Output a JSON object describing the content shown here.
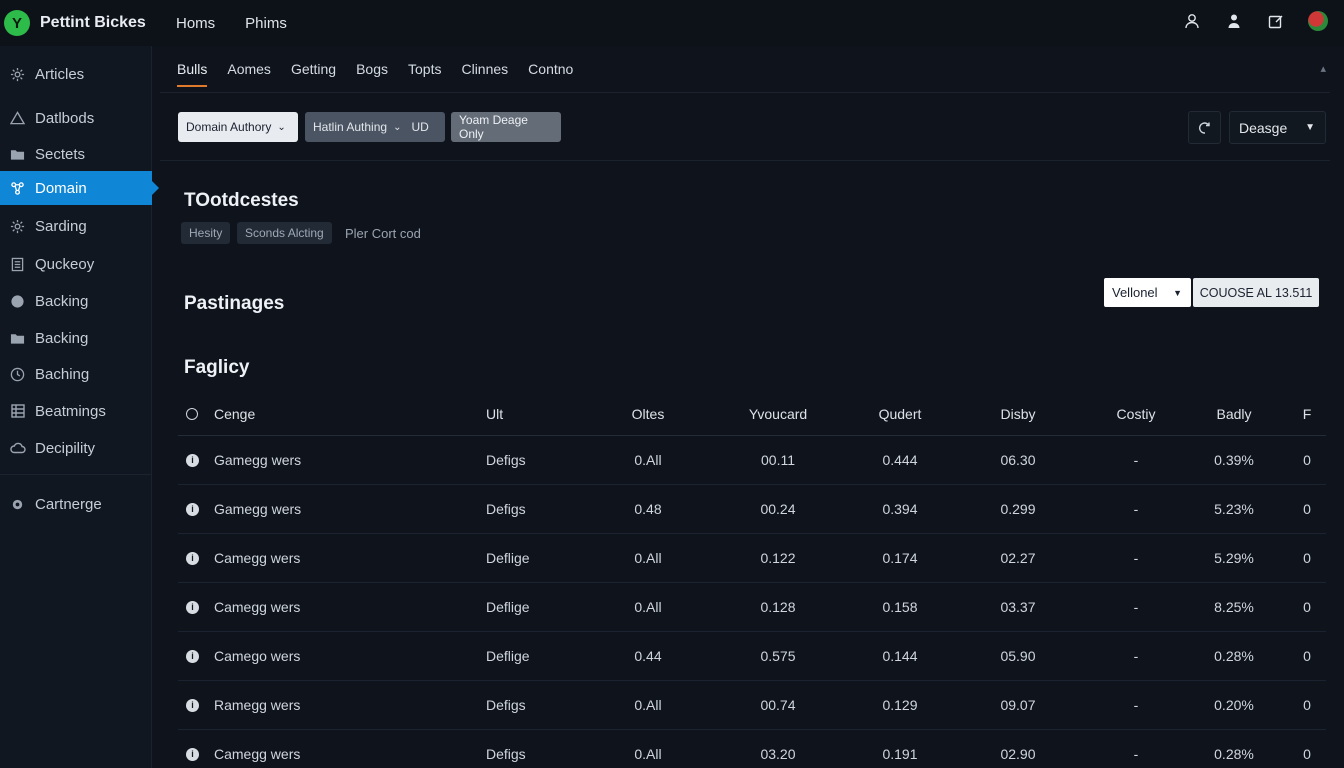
{
  "app": {
    "brand_letter": "Y",
    "brand_name": "Pettint Bickes",
    "brand_color": "#2dbb4a",
    "accent_color": "#0f86d6",
    "tab_indicator_color": "#e07a2d"
  },
  "topnav": {
    "items": [
      "Homs",
      "Phims"
    ]
  },
  "top_icons": [
    "user-icon",
    "person-icon",
    "edit-icon",
    "avatar"
  ],
  "sidebar": {
    "items": [
      {
        "label": "Articles",
        "icon": "gear-icon"
      },
      {
        "label": "Datlbods",
        "icon": "triangle-icon"
      },
      {
        "label": "Sectets",
        "icon": "folder-icon"
      },
      {
        "label": "Domain",
        "icon": "network-icon",
        "active": true
      },
      {
        "label": "Sarding",
        "icon": "gear-icon"
      },
      {
        "label": "Quckeoy",
        "icon": "document-icon"
      },
      {
        "label": "Backing",
        "icon": "globe-icon"
      },
      {
        "label": "Backing",
        "icon": "folder-icon"
      },
      {
        "label": "Baching",
        "icon": "clock-icon"
      },
      {
        "label": "Beatmings",
        "icon": "grid-icon"
      },
      {
        "label": "Decipility",
        "icon": "cloud-icon"
      },
      {
        "label": "Cartnerge",
        "icon": "gear-icon"
      }
    ]
  },
  "subtabs": {
    "items": [
      "Bulls",
      "Aomes",
      "Getting",
      "Bogs",
      "Topts",
      "Clinnes",
      "Contno"
    ],
    "active_index": 0
  },
  "filters": {
    "domain_authority": "Domain Authory",
    "hatlin_authing": "Hatlin Authing",
    "hatlin_extra": "UD",
    "yoam_deage": "Yoam Deage Only",
    "dropdown_label": "Deasge"
  },
  "section1": {
    "title": "TOotdcestes",
    "chips": [
      "Hesity",
      "Sconds Alcting"
    ],
    "note": "Pler Cort cod"
  },
  "section2": {
    "title": "Pastinages",
    "select_value": "Vellonel",
    "code_label": "COUOSE AL 13.511"
  },
  "section3": {
    "title": "Faglicy"
  },
  "table": {
    "headers": [
      "Cenge",
      "Ult",
      "Oltes",
      "Yvoucard",
      "Qudert",
      "Disby",
      "Costiy",
      "Badly",
      "F"
    ],
    "rows": [
      [
        "Gamegg wers",
        "Defigs",
        "0.All",
        "00.11",
        "0.444",
        "06.30",
        "-",
        "0.39%",
        "0"
      ],
      [
        "Gamegg wers",
        "Defigs",
        "0.48",
        "00.24",
        "0.394",
        "0.299",
        "-",
        "5.23%",
        "0"
      ],
      [
        "Camegg wers",
        "Deflige",
        "0.All",
        "0.122",
        "0.174",
        "02.27",
        "-",
        "5.29%",
        "0"
      ],
      [
        "Camegg wers",
        "Deflige",
        "0.All",
        "0.128",
        "0.158",
        "03.37",
        "-",
        "8.25%",
        "0"
      ],
      [
        "Camego wers",
        "Deflige",
        "0.44",
        "0.575",
        "0.144",
        "05.90",
        "-",
        "0.28%",
        "0"
      ],
      [
        "Ramegg wers",
        "Defigs",
        "0.All",
        "00.74",
        "0.129",
        "09.07",
        "-",
        "0.20%",
        "0"
      ],
      [
        "Camegg wers",
        "Defigs",
        "0.All",
        "03.20",
        "0.191",
        "02.90",
        "-",
        "0.28%",
        "0"
      ]
    ]
  }
}
